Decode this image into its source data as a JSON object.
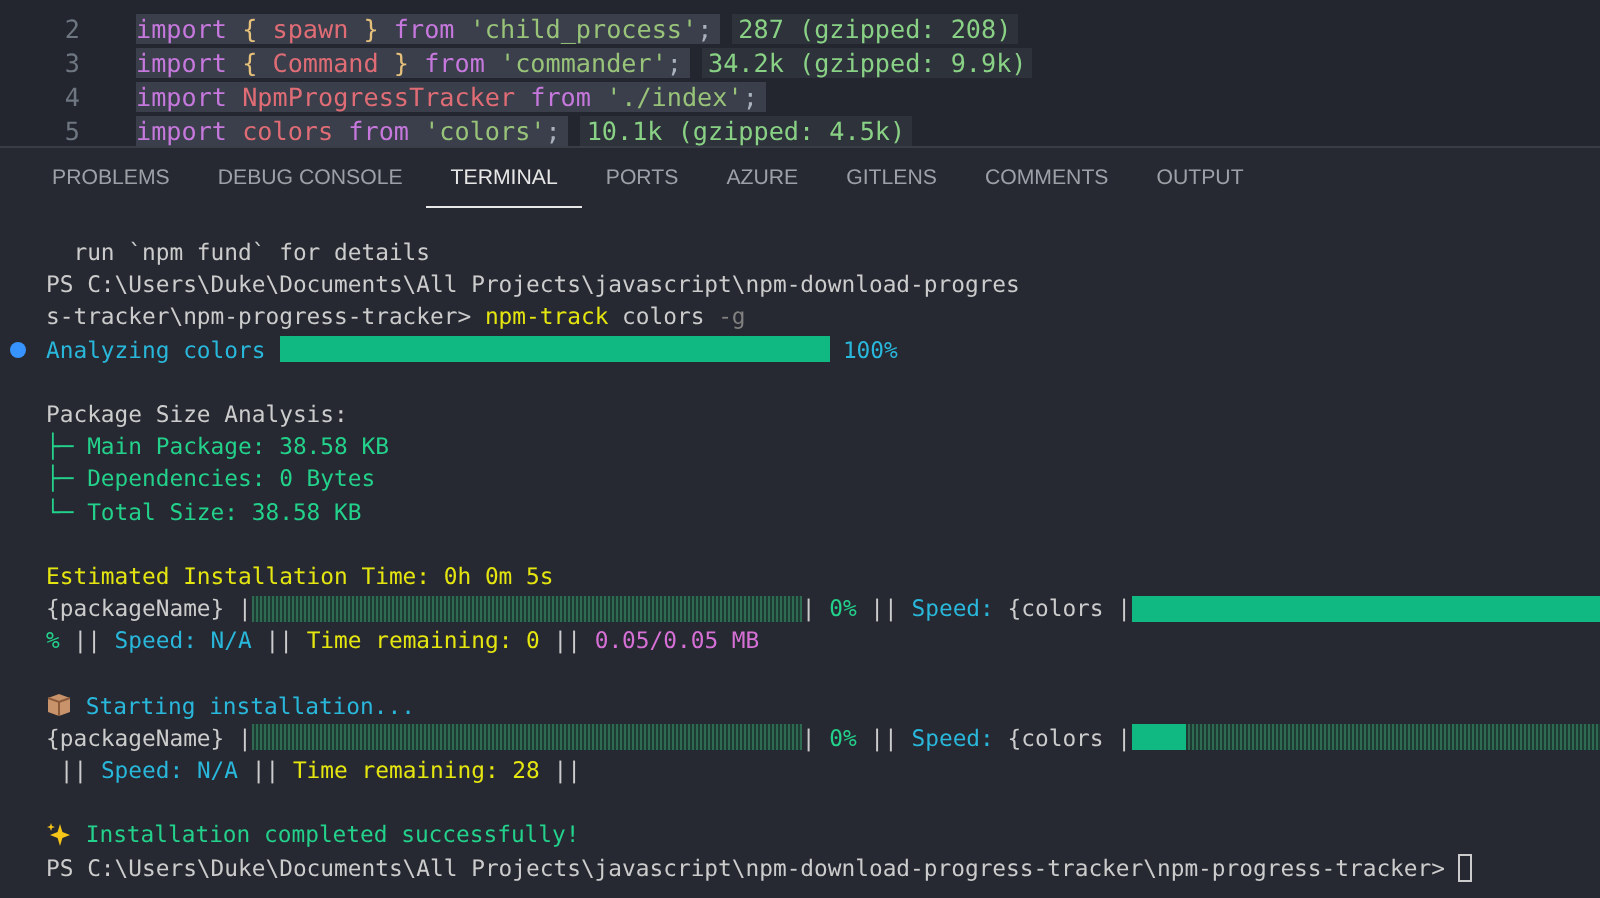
{
  "editor": {
    "lines": [
      {
        "number": "2",
        "selected": true,
        "segments": [
          {
            "kind": "keyword",
            "text": "import "
          },
          {
            "kind": "brace",
            "text": "{"
          },
          {
            "kind": "name",
            "text": " spawn "
          },
          {
            "kind": "brace",
            "text": "}"
          },
          {
            "kind": "keyword",
            "text": " from "
          },
          {
            "kind": "string",
            "text": "'child_process'"
          },
          {
            "kind": "plain",
            "text": ";"
          }
        ],
        "size": "287 (gzipped: 208)"
      },
      {
        "number": "3",
        "selected": true,
        "segments": [
          {
            "kind": "keyword",
            "text": "import "
          },
          {
            "kind": "brace",
            "text": "{"
          },
          {
            "kind": "name",
            "text": " Command "
          },
          {
            "kind": "brace",
            "text": "}"
          },
          {
            "kind": "keyword",
            "text": " from "
          },
          {
            "kind": "string",
            "text": "'commander'"
          },
          {
            "kind": "plain",
            "text": ";"
          }
        ],
        "size": "34.2k (gzipped: 9.9k)"
      },
      {
        "number": "4",
        "selected": true,
        "segments": [
          {
            "kind": "keyword",
            "text": "import "
          },
          {
            "kind": "name",
            "text": "NpmProgressTracker "
          },
          {
            "kind": "keyword",
            "text": "from "
          },
          {
            "kind": "string",
            "text": "'./index'"
          },
          {
            "kind": "plain",
            "text": ";"
          }
        ]
      },
      {
        "number": "5",
        "selected": true,
        "segments": [
          {
            "kind": "keyword",
            "text": "import "
          },
          {
            "kind": "name",
            "text": "colors "
          },
          {
            "kind": "keyword",
            "text": "from "
          },
          {
            "kind": "string",
            "text": "'colors'"
          },
          {
            "kind": "plain",
            "text": ";"
          }
        ],
        "size": "10.1k (gzipped: 4.5k)"
      }
    ]
  },
  "panel_tabs": [
    {
      "label": "PROBLEMS",
      "selected": false
    },
    {
      "label": "DEBUG CONSOLE",
      "selected": false
    },
    {
      "label": "TERMINAL",
      "selected": true
    },
    {
      "label": "PORTS",
      "selected": false
    },
    {
      "label": "AZURE",
      "selected": false
    },
    {
      "label": "GITLENS",
      "selected": false
    },
    {
      "label": "COMMENTS",
      "selected": false
    },
    {
      "label": "OUTPUT",
      "selected": false
    }
  ],
  "terminal": {
    "lines": [
      {
        "space_before": false,
        "marker": false,
        "segments": [
          {
            "kind": "plain",
            "text": "  run `npm fund` for details"
          }
        ]
      },
      {
        "space_before": false,
        "marker": false,
        "segments": [
          {
            "kind": "plain",
            "text": "PS C:\\Users\\Duke\\Documents\\All Projects\\javascript\\npm-download-progres"
          }
        ]
      },
      {
        "space_before": false,
        "marker": false,
        "segments": [
          {
            "kind": "plain",
            "text": "s-tracker\\npm-progress-tracker> "
          },
          {
            "kind": "yellow",
            "text": "npm-track"
          },
          {
            "kind": "plain",
            "text": " colors "
          },
          {
            "kind": "dim",
            "text": "-g"
          }
        ]
      },
      {
        "space_before": false,
        "marker": true,
        "segments": [
          {
            "kind": "cyan",
            "text": "Analyzing colors "
          },
          {
            "kind": "bar",
            "level": 1
          },
          {
            "kind": "cyan",
            "text": " 100%"
          }
        ]
      },
      {
        "space_before": true,
        "marker": false,
        "segments": [
          {
            "kind": "plain",
            "text": "Package Size Analysis:"
          }
        ]
      },
      {
        "space_before": false,
        "marker": false,
        "segments": [
          {
            "kind": "green",
            "text": "├─ Main Package: 38.58 KB"
          }
        ]
      },
      {
        "space_before": false,
        "marker": false,
        "segments": [
          {
            "kind": "green",
            "text": "├─ Dependencies: 0 Bytes"
          }
        ]
      },
      {
        "space_before": false,
        "marker": false,
        "segments": [
          {
            "kind": "green",
            "text": "└─ Total Size: 38.58 KB"
          }
        ]
      },
      {
        "space_before": true,
        "marker": false,
        "segments": [
          {
            "kind": "yellow",
            "text": "Estimated Installation Time: 0h 0m 5s"
          }
        ]
      },
      {
        "space_before": false,
        "marker": false,
        "segments": [
          {
            "kind": "plain",
            "text": "{packageName} |"
          },
          {
            "kind": "bar",
            "level": 0
          },
          {
            "kind": "plain",
            "text": "| "
          },
          {
            "kind": "green",
            "text": "0%"
          },
          {
            "kind": "plain",
            "text": " || "
          },
          {
            "kind": "cyan",
            "text": "Speed: "
          },
          {
            "kind": "plain",
            "text": "{colors |"
          },
          {
            "kind": "bar",
            "level": 1
          }
        ]
      },
      {
        "space_before": false,
        "marker": false,
        "segments": [
          {
            "kind": "green",
            "text": "%"
          },
          {
            "kind": "plain",
            "text": " || "
          },
          {
            "kind": "cyan",
            "text": "Speed: N/A"
          },
          {
            "kind": "plain",
            "text": " || "
          },
          {
            "kind": "yellow",
            "text": "Time remaining: 0"
          },
          {
            "kind": "plain",
            "text": " || "
          },
          {
            "kind": "magenta",
            "text": "0.05/0.05 MB"
          }
        ]
      },
      {
        "space_before": true,
        "marker": false,
        "segments": [
          {
            "kind": "start_icon"
          },
          {
            "kind": "cyan",
            "text": " Starting installation..."
          }
        ]
      },
      {
        "space_before": false,
        "marker": false,
        "segments": [
          {
            "kind": "plain",
            "text": "{packageName} |"
          },
          {
            "kind": "bar",
            "level": 0
          },
          {
            "kind": "plain",
            "text": "| "
          },
          {
            "kind": "green",
            "text": "0%"
          },
          {
            "kind": "plain",
            "text": " || "
          },
          {
            "kind": "cyan",
            "text": "Speed: "
          },
          {
            "kind": "plain",
            "text": "{colors |"
          },
          {
            "kind": "bar",
            "level": 0.1
          }
        ]
      },
      {
        "space_before": false,
        "marker": false,
        "segments": [
          {
            "kind": "plain",
            "text": " || "
          },
          {
            "kind": "cyan",
            "text": "Speed: N/A"
          },
          {
            "kind": "plain",
            "text": " || "
          },
          {
            "kind": "yellow",
            "text": "Time remaining: 28"
          },
          {
            "kind": "plain",
            "text": " ||"
          }
        ]
      },
      {
        "space_before": true,
        "marker": false,
        "segments": [
          {
            "kind": "done_icon"
          },
          {
            "kind": "green",
            "text": " Installation completed successfully!"
          }
        ]
      },
      {
        "space_before": false,
        "marker": false,
        "segments": [
          {
            "kind": "plain",
            "text": "PS C:\\Users\\Duke\\Documents\\All Projects\\javascript\\npm-download-progress-tracker\\npm-progress-tracker> "
          },
          {
            "kind": "cursor"
          }
        ]
      }
    ]
  }
}
